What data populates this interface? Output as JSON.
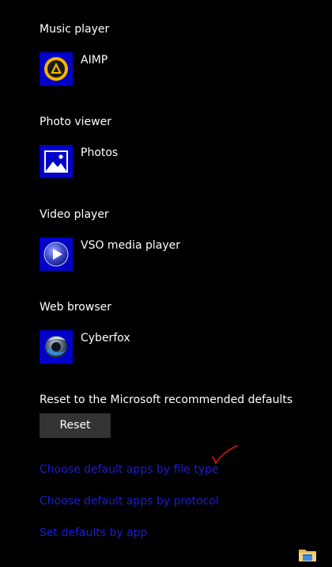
{
  "sections": [
    {
      "label": "Music player",
      "app": {
        "name": "AIMP",
        "icon": "aimp-icon"
      }
    },
    {
      "label": "Photo viewer",
      "app": {
        "name": "Photos",
        "icon": "photos-icon"
      }
    },
    {
      "label": "Video player",
      "app": {
        "name": "VSO media player",
        "icon": "vso-media-player-icon"
      }
    },
    {
      "label": "Web browser",
      "app": {
        "name": "Cyberfox",
        "icon": "cyberfox-icon"
      }
    }
  ],
  "reset": {
    "label": "Reset to the Microsoft recommended defaults",
    "button_label": "Reset"
  },
  "links": {
    "file_type": "Choose default apps by file type",
    "protocol": "Choose default apps by protocol",
    "set_by_app": "Set defaults by app"
  },
  "annotation": {
    "icon": "red-checkmark-icon",
    "color": "#e0101a"
  },
  "taskbar": {
    "icon": "file-explorer-icon"
  },
  "colors": {
    "background": "#000000",
    "app_icon_tile": "#0000c8",
    "link": "#1c1ccf",
    "button": "#333333"
  }
}
